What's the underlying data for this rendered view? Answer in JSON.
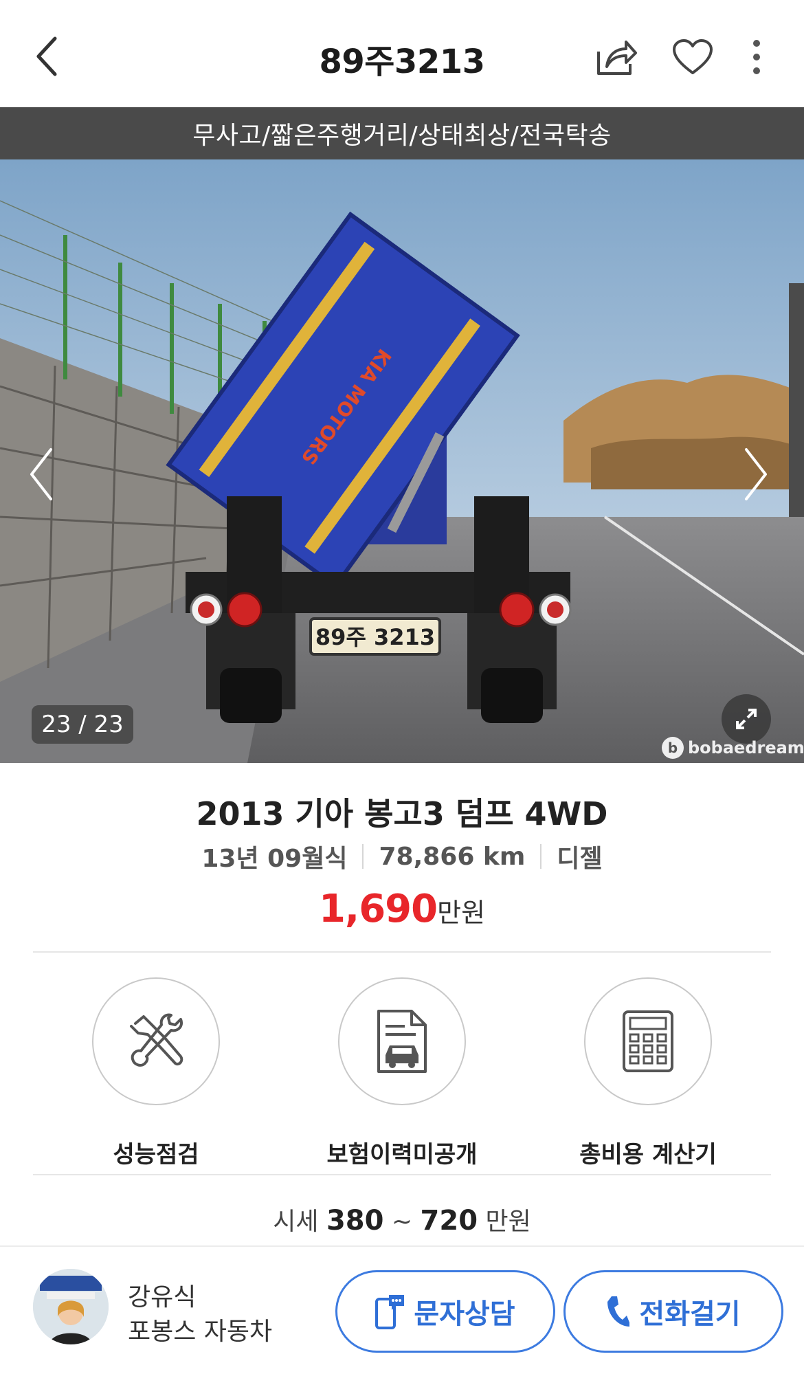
{
  "header": {
    "title": "89주3213",
    "icons": {
      "back": "chevron-left-icon",
      "share": "share-icon",
      "favorite": "heart-icon",
      "more": "more-vertical-icon"
    }
  },
  "banner": {
    "text": "무사고/짧은주행거리/상태최상/전국탁송"
  },
  "photo": {
    "counter": "23 / 23",
    "plate_text": "89주 3213",
    "body_text": "KIA MOTORS",
    "watermark": "bobaedream"
  },
  "car": {
    "title": "2013 기아 봉고3 덤프 4WD",
    "year": "13년 09월식",
    "mileage": "78,866 km",
    "fuel": "디젤",
    "price_value": "1,690",
    "price_unit": "만원",
    "price_color": "#e8262a"
  },
  "features": [
    {
      "label": "성능점검",
      "icon": "tools-icon"
    },
    {
      "label": "보험이력미공개",
      "icon": "car-document-icon"
    },
    {
      "label": "총비용 계산기",
      "icon": "calculator-icon"
    }
  ],
  "market": {
    "label": "시세",
    "min": "380",
    "separator": "~",
    "max": "720",
    "unit": "만원"
  },
  "dealer": {
    "name": "강유식",
    "shop": "포봉스 자동차"
  },
  "actions": {
    "sms_label": "문자상담",
    "call_label": "전화걸기",
    "accent": "#3d7be0"
  }
}
